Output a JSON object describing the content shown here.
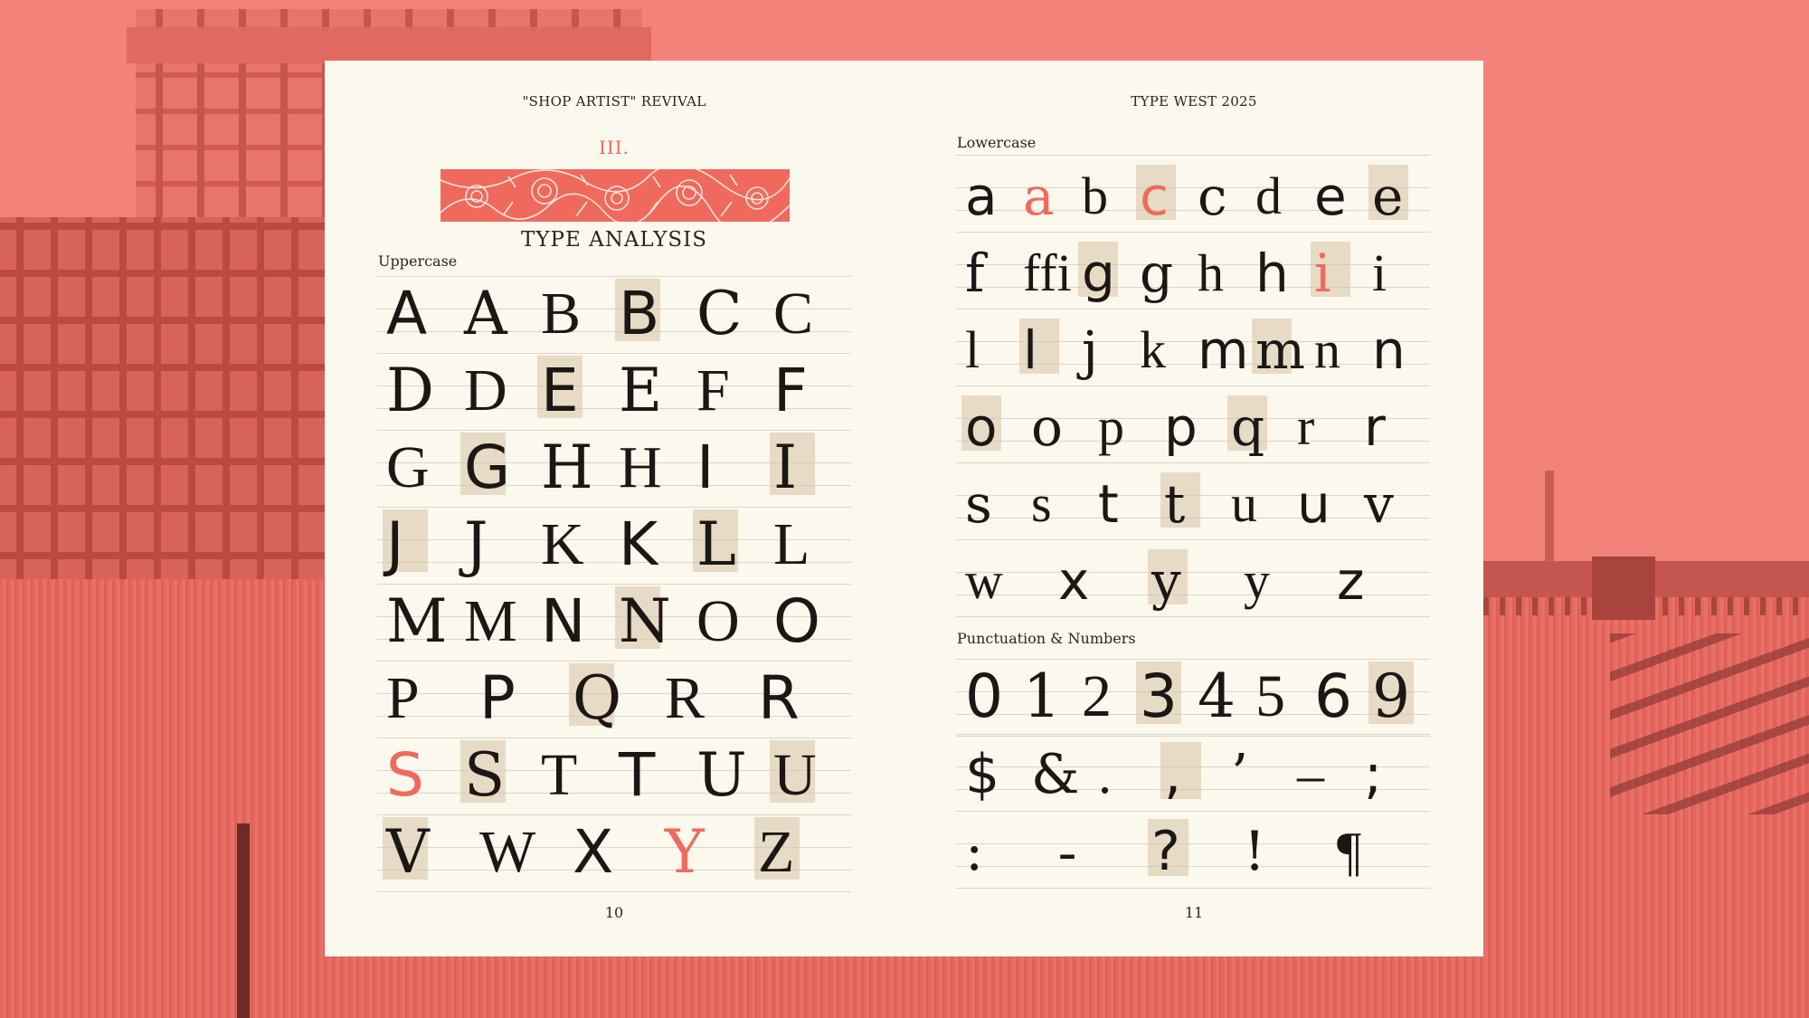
{
  "left_page": {
    "running_head": "\"SHOP ARTIST\" REVIVAL",
    "chapter": "III.",
    "title": "TYPE ANALYSIS",
    "section": "Uppercase",
    "page_number": "10"
  },
  "right_page": {
    "running_head": "TYPE WEST 2025",
    "lowercase_section": "Lowercase",
    "punct_section": "Punctuation & Numbers",
    "page_number": "11"
  },
  "colors": {
    "accent": "#ef6a5c",
    "paper": "#fbf8ee",
    "ink": "#1c1714",
    "background": "#f07e74",
    "scan_tan": "#d7c2a6"
  },
  "uppercase_rows": [
    [
      "A",
      "A",
      "B",
      "B",
      "C",
      "C"
    ],
    [
      "D",
      "D",
      "E",
      "E",
      "F",
      "F"
    ],
    [
      "G",
      "G",
      "H",
      "H",
      "I",
      "I"
    ],
    [
      "J",
      "J",
      "K",
      "K",
      "L",
      "L"
    ],
    [
      "M",
      "M",
      "N",
      "N",
      "O",
      "O"
    ],
    [
      "P",
      "P",
      "Q",
      "R",
      "R"
    ],
    [
      "S",
      "S",
      "T",
      "T",
      "U",
      "U"
    ],
    [
      "V",
      "W",
      "X",
      "Y",
      "Z"
    ]
  ],
  "lowercase_rows": [
    [
      "a",
      "a",
      "b",
      "c",
      "c",
      "d",
      "e",
      "e"
    ],
    [
      "f",
      "ffi",
      "g",
      "g",
      "h",
      "h",
      "i",
      "i"
    ],
    [
      "l",
      "l",
      "j",
      "k",
      "m",
      "m",
      "n",
      "n"
    ],
    [
      "o",
      "o",
      "p",
      "p",
      "q",
      "r",
      "r"
    ],
    [
      "s",
      "s",
      "t",
      "t",
      "u",
      "u",
      "v"
    ],
    [
      "w",
      "x",
      "y",
      "y",
      "z"
    ]
  ],
  "numbers_row": [
    "0",
    "1",
    "2",
    "3",
    "4",
    "5",
    "6",
    "9"
  ],
  "punct_rows": [
    [
      "$",
      "&",
      ".",
      ",",
      "’",
      "–",
      ";"
    ],
    [
      ":",
      "-",
      "?",
      "!",
      "¶"
    ]
  ]
}
